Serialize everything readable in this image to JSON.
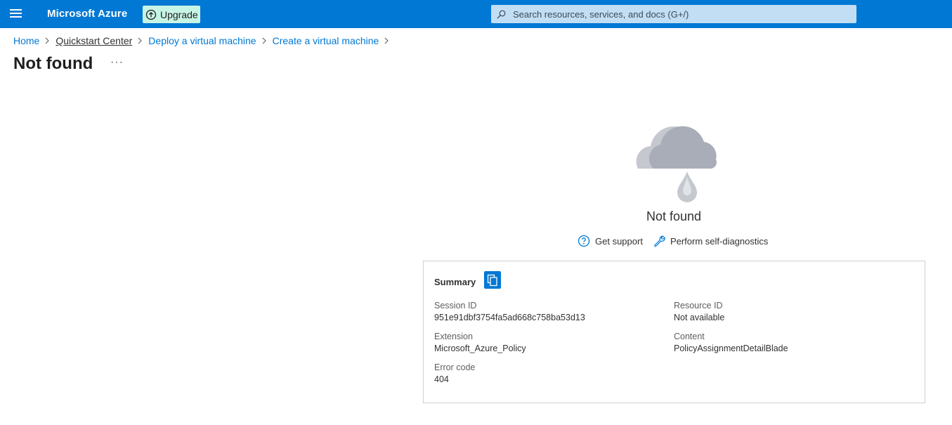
{
  "topbar": {
    "brand": "Microsoft Azure",
    "upgrade_label": "Upgrade",
    "search_placeholder": "Search resources, services, and docs (G+/)",
    "color": "#0078d4"
  },
  "breadcrumb": {
    "items": [
      "Home",
      "Quickstart Center",
      "Deploy a virtual machine",
      "Create a virtual machine"
    ]
  },
  "page": {
    "title": "Not found",
    "more_label": "···"
  },
  "error": {
    "heading": "Not found",
    "get_support": "Get support",
    "self_diagnostics": "Perform self-diagnostics"
  },
  "summary": {
    "title": "Summary",
    "session_id_label": "Session ID",
    "session_id": "951e91dbf3754fa5ad668c758ba53d13",
    "resource_id_label": "Resource ID",
    "resource_id": "Not available",
    "extension_label": "Extension",
    "extension": "Microsoft_Azure_Policy",
    "content_label": "Content",
    "content": "PolicyAssignmentDetailBlade",
    "error_code_label": "Error code",
    "error_code": "404"
  }
}
